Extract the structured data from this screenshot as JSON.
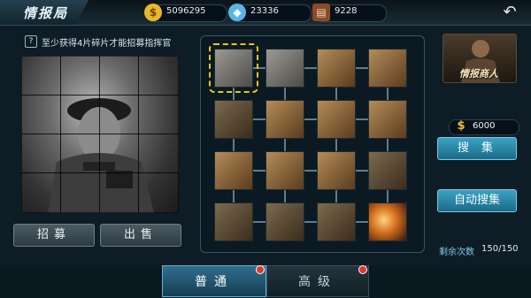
{
  "header": {
    "title": "情报局",
    "resources": [
      {
        "icon": "gold-coin-icon",
        "value": "5096295"
      },
      {
        "icon": "diamond-icon",
        "value": "23336"
      },
      {
        "icon": "book-icon",
        "value": "9228"
      }
    ]
  },
  "left": {
    "hint": "至少获得4片碎片才能招募指挥官",
    "recruit_label": "招募",
    "sell_label": "出售"
  },
  "right": {
    "merchant_label": "情报商人",
    "price": "6000",
    "collect_label": "搜集",
    "auto_collect_label": "自动搜集",
    "remaining_label": "剩余次数",
    "remaining_value": "150/150"
  },
  "tabs": [
    {
      "label": "普通",
      "active": true
    },
    {
      "label": "高级",
      "active": false
    }
  ]
}
